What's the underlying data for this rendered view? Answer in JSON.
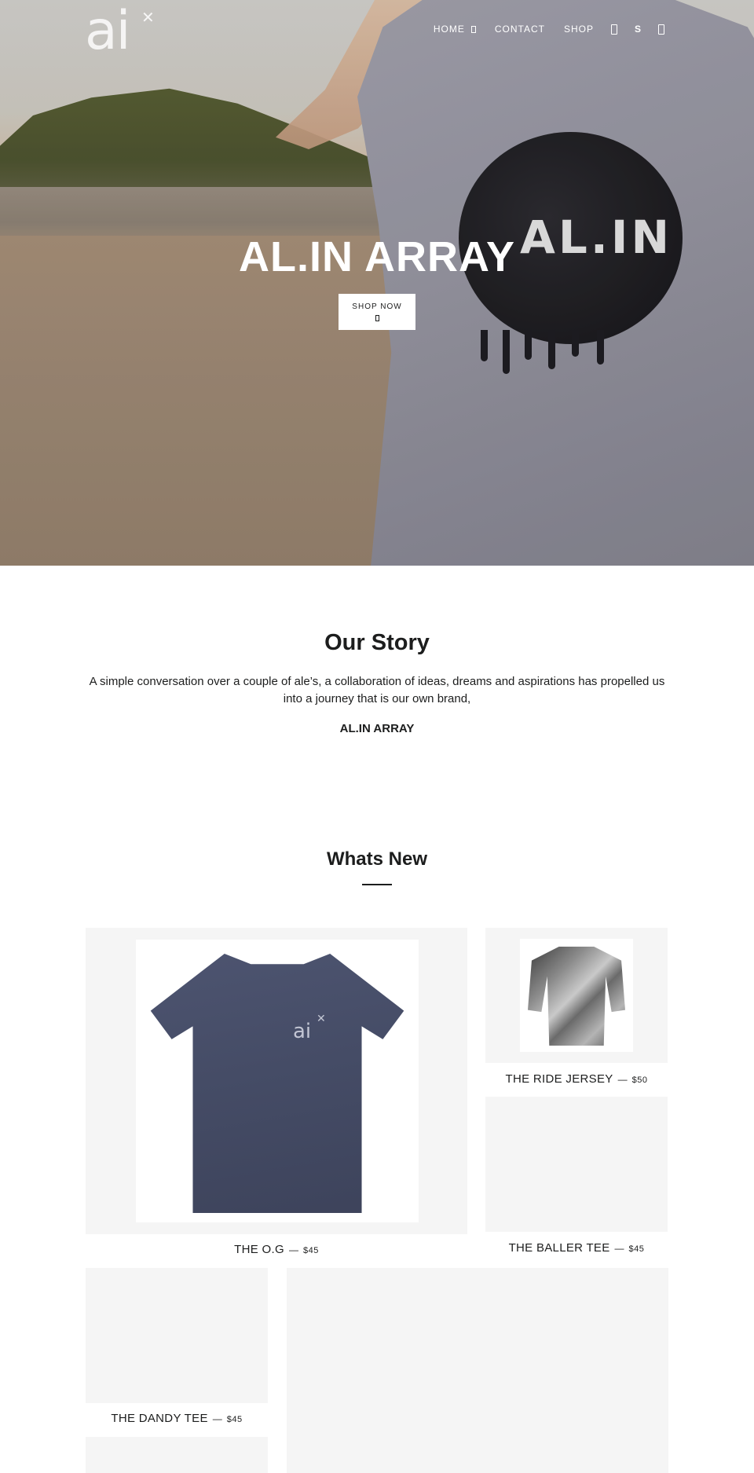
{
  "header": {
    "logo_text": "ai",
    "nav": [
      {
        "label": "HOME",
        "has_dropdown": true
      },
      {
        "label": "CONTACT",
        "has_dropdown": false
      },
      {
        "label": "SHOP",
        "has_dropdown": false
      }
    ],
    "icons": [
      "search-icon",
      "account-icon",
      "cart-icon"
    ],
    "account_glyph": "S"
  },
  "hero": {
    "title": "AL.IN ARRAY",
    "button_label": "SHOP NOW",
    "shirt_print": "AL.IN"
  },
  "story": {
    "title": "Our Story",
    "text": "A simple conversation over a couple of ale’s, a collaboration of ideas, dreams and aspirations has propelled us into a journey that is our own brand,",
    "brand": "AL.IN ARRAY"
  },
  "whats_new": {
    "title": "Whats New",
    "products": [
      {
        "name": "THE O.G",
        "separator": "—",
        "price": "$45"
      },
      {
        "name": "THE RIDE JERSEY",
        "separator": "—",
        "price": "$50"
      },
      {
        "name": "THE BALLER TEE",
        "separator": "—",
        "price": "$45"
      },
      {
        "name": "THE DANDY TEE",
        "separator": "—",
        "price": "$45"
      }
    ]
  },
  "colors": {
    "text": "#1c1d1d",
    "image_placeholder": "#f5f5f5",
    "hero_text": "#ffffff"
  }
}
